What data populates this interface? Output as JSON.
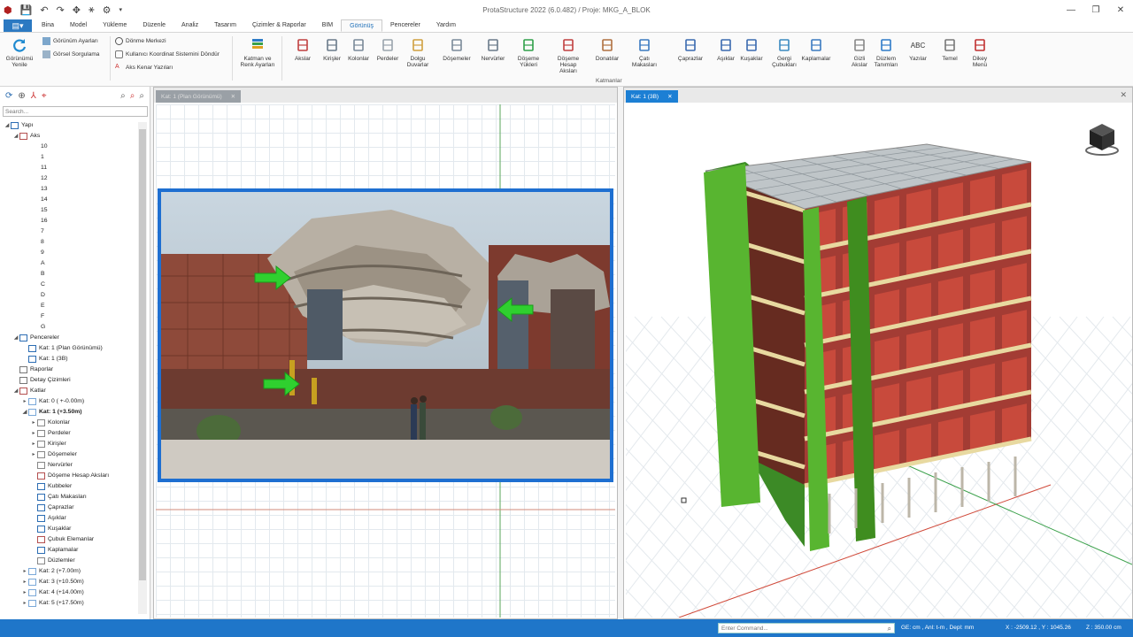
{
  "app": {
    "title": "ProtaStructure 2022 (6.0.482) / Proje: MKG_A_BLOK"
  },
  "menu": {
    "tabs": [
      "Bina",
      "Model",
      "Yükleme",
      "Düzenle",
      "Analiz",
      "Tasarım",
      "Çizimler & Raporlar",
      "BIM",
      "Görünüş",
      "Pencereler",
      "Yardım"
    ],
    "active": "Görünüş"
  },
  "ribbon": {
    "refresh": {
      "label1": "Görünümü",
      "label2": "Yenile"
    },
    "small_left": [
      "Görünüm Ayarları",
      "Görsel Sorgulama"
    ],
    "small_mid": [
      "Dönme Merkezi",
      "Kullanıcı Koordinat Sistemini Döndür",
      "Aks Kenar Yazıları"
    ],
    "layer_color": {
      "label1": "Katman ve",
      "label2": "Renk Ayarları"
    },
    "buttons": [
      {
        "l1": "Akslar",
        "l2": ""
      },
      {
        "l1": "Kirişler",
        "l2": ""
      },
      {
        "l1": "Kolonlar",
        "l2": ""
      },
      {
        "l1": "Perdeler",
        "l2": ""
      },
      {
        "l1": "Dolgu",
        "l2": "Duvarlar"
      },
      {
        "l1": "Döşemeler",
        "l2": ""
      },
      {
        "l1": "Nervürler",
        "l2": ""
      },
      {
        "l1": "Döşeme",
        "l2": "Yükleri"
      },
      {
        "l1": "Döşeme Hesap",
        "l2": "Aksları"
      },
      {
        "l1": "Donatılar",
        "l2": ""
      },
      {
        "l1": "Çatı Makasları",
        "l2": ""
      },
      {
        "l1": "Çaprazlar",
        "l2": ""
      },
      {
        "l1": "Aşıklar",
        "l2": ""
      },
      {
        "l1": "Kuşaklar",
        "l2": ""
      },
      {
        "l1": "Gergi",
        "l2": "Çubukları"
      },
      {
        "l1": "Kaplamalar",
        "l2": ""
      },
      {
        "l1": "Gizli",
        "l2": "Akslar"
      },
      {
        "l1": "Düzlem",
        "l2": "Tanımları"
      },
      {
        "l1": "Yazılar",
        "l2": ""
      },
      {
        "l1": "Temel",
        "l2": ""
      },
      {
        "l1": "Dikey",
        "l2": "Menü"
      }
    ],
    "group_label": "Katmanlar",
    "abc": "ABC"
  },
  "tree": {
    "search_placeholder": "Search...",
    "nodes": [
      {
        "t": "Yapı",
        "lvl": 0,
        "tw": "◢",
        "bold": false,
        "ic": "#2c6db3"
      },
      {
        "t": "Aks",
        "lvl": 1,
        "tw": "◢",
        "bold": false,
        "ic": "#b45050"
      },
      {
        "t": "10",
        "lvl": 2,
        "tw": "",
        "bold": false,
        "ic": ""
      },
      {
        "t": "1",
        "lvl": 2,
        "tw": "",
        "bold": false,
        "ic": ""
      },
      {
        "t": "11",
        "lvl": 2,
        "tw": "",
        "bold": false,
        "ic": ""
      },
      {
        "t": "12",
        "lvl": 2,
        "tw": "",
        "bold": false,
        "ic": ""
      },
      {
        "t": "13",
        "lvl": 2,
        "tw": "",
        "bold": false,
        "ic": ""
      },
      {
        "t": "14",
        "lvl": 2,
        "tw": "",
        "bold": false,
        "ic": ""
      },
      {
        "t": "15",
        "lvl": 2,
        "tw": "",
        "bold": false,
        "ic": ""
      },
      {
        "t": "16",
        "lvl": 2,
        "tw": "",
        "bold": false,
        "ic": ""
      },
      {
        "t": "7",
        "lvl": 2,
        "tw": "",
        "bold": false,
        "ic": ""
      },
      {
        "t": "8",
        "lvl": 2,
        "tw": "",
        "bold": false,
        "ic": ""
      },
      {
        "t": "9",
        "lvl": 2,
        "tw": "",
        "bold": false,
        "ic": ""
      },
      {
        "t": "A",
        "lvl": 2,
        "tw": "",
        "bold": false,
        "ic": ""
      },
      {
        "t": "B",
        "lvl": 2,
        "tw": "",
        "bold": false,
        "ic": ""
      },
      {
        "t": "C",
        "lvl": 2,
        "tw": "",
        "bold": false,
        "ic": ""
      },
      {
        "t": "D",
        "lvl": 2,
        "tw": "",
        "bold": false,
        "ic": ""
      },
      {
        "t": "E",
        "lvl": 2,
        "tw": "",
        "bold": false,
        "ic": ""
      },
      {
        "t": "F",
        "lvl": 2,
        "tw": "",
        "bold": false,
        "ic": ""
      },
      {
        "t": "G",
        "lvl": 2,
        "tw": "",
        "bold": false,
        "ic": ""
      },
      {
        "t": "Pencereler",
        "lvl": 1,
        "tw": "◢",
        "bold": false,
        "ic": "#2c6db3"
      },
      {
        "t": "Kat: 1 (Plan Görünümü)",
        "lvl": 2,
        "tw": "",
        "bold": false,
        "ic": "#2c6db3"
      },
      {
        "t": "Kat: 1 (3B)",
        "lvl": 2,
        "tw": "",
        "bold": false,
        "ic": "#2c6db3"
      },
      {
        "t": "Raporlar",
        "lvl": 1,
        "tw": "",
        "bold": false,
        "ic": "#777"
      },
      {
        "t": "Detay Çizimleri",
        "lvl": 1,
        "tw": "",
        "bold": false,
        "ic": "#777"
      },
      {
        "t": "Katlar",
        "lvl": 1,
        "tw": "◢",
        "bold": false,
        "ic": "#b45050"
      },
      {
        "t": "Kat: 0 ( +-0.00m)",
        "lvl": 2,
        "tw": "▸",
        "bold": false,
        "ic": "#7aa8d8"
      },
      {
        "t": "Kat: 1 (+3.50m)",
        "lvl": 2,
        "tw": "◢",
        "bold": true,
        "ic": "#7aa8d8"
      },
      {
        "t": "Kolonlar",
        "lvl": 3,
        "tw": "▸",
        "bold": false,
        "ic": "#888"
      },
      {
        "t": "Perdeler",
        "lvl": 3,
        "tw": "▸",
        "bold": false,
        "ic": "#888"
      },
      {
        "t": "Kirişler",
        "lvl": 3,
        "tw": "▸",
        "bold": false,
        "ic": "#888"
      },
      {
        "t": "Döşemeler",
        "lvl": 3,
        "tw": "▸",
        "bold": false,
        "ic": "#888"
      },
      {
        "t": "Nervürler",
        "lvl": 3,
        "tw": "",
        "bold": false,
        "ic": "#888"
      },
      {
        "t": "Döşeme Hesap Aksları",
        "lvl": 3,
        "tw": "",
        "bold": false,
        "ic": "#b45050"
      },
      {
        "t": "Kubbeler",
        "lvl": 3,
        "tw": "",
        "bold": false,
        "ic": "#2c6db3"
      },
      {
        "t": "Çatı Makasları",
        "lvl": 3,
        "tw": "",
        "bold": false,
        "ic": "#2c6db3"
      },
      {
        "t": "Çaprazlar",
        "lvl": 3,
        "tw": "",
        "bold": false,
        "ic": "#2c6db3"
      },
      {
        "t": "Aşıklar",
        "lvl": 3,
        "tw": "",
        "bold": false,
        "ic": "#2c6db3"
      },
      {
        "t": "Kuşaklar",
        "lvl": 3,
        "tw": "",
        "bold": false,
        "ic": "#2c6db3"
      },
      {
        "t": "Çubuk Elemanlar",
        "lvl": 3,
        "tw": "",
        "bold": false,
        "ic": "#b45050"
      },
      {
        "t": "Kaplamalar",
        "lvl": 3,
        "tw": "",
        "bold": false,
        "ic": "#2c6db3"
      },
      {
        "t": "Düzlemler",
        "lvl": 3,
        "tw": "",
        "bold": false,
        "ic": "#888"
      },
      {
        "t": "Kat: 2 (+7.00m)",
        "lvl": 2,
        "tw": "▸",
        "bold": false,
        "ic": "#7aa8d8"
      },
      {
        "t": "Kat: 3 (+10.50m)",
        "lvl": 2,
        "tw": "▸",
        "bold": false,
        "ic": "#7aa8d8"
      },
      {
        "t": "Kat: 4 (+14.00m)",
        "lvl": 2,
        "tw": "▸",
        "bold": false,
        "ic": "#7aa8d8"
      },
      {
        "t": "Kat: 5 (+17.50m)",
        "lvl": 2,
        "tw": "▸",
        "bold": false,
        "ic": "#7aa8d8"
      }
    ]
  },
  "plan_tab": {
    "label": "Kat: 1 (Plan Görünümü)",
    "close": "✕"
  },
  "view_tab": {
    "label": "Kat: 1 (3B)",
    "close": "✕"
  },
  "status": {
    "command_placeholder": "Enter Command...",
    "units": "GE: cm , Anl: t-m , Depl: mm",
    "coords": "X : -2509.12 , Y : 1045.26",
    "z": "Z : 350.00 cm"
  }
}
